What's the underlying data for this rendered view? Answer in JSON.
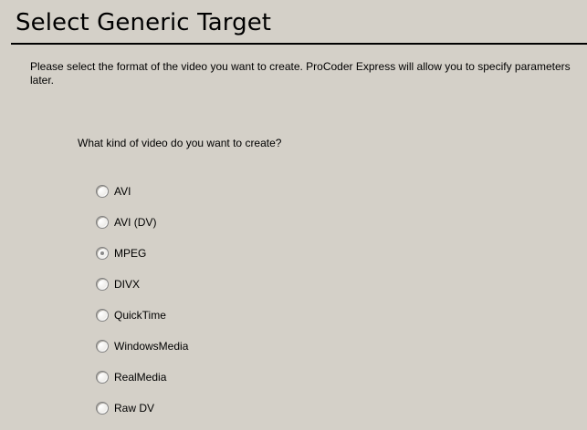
{
  "page": {
    "title": "Select Generic Target",
    "description": "Please select the format of the video you want to create. ProCoder Express will allow you to specify parameters later.",
    "question": "What kind of video do you want to create?"
  },
  "options": [
    {
      "label": "AVI",
      "selected": false
    },
    {
      "label": "AVI (DV)",
      "selected": false
    },
    {
      "label": "MPEG",
      "selected": true
    },
    {
      "label": "DIVX",
      "selected": false
    },
    {
      "label": "QuickTime",
      "selected": false
    },
    {
      "label": "WindowsMedia",
      "selected": false
    },
    {
      "label": "RealMedia",
      "selected": false
    },
    {
      "label": "Raw DV",
      "selected": false
    }
  ],
  "colors": {
    "background": "#d4d0c8",
    "text": "#000000"
  }
}
